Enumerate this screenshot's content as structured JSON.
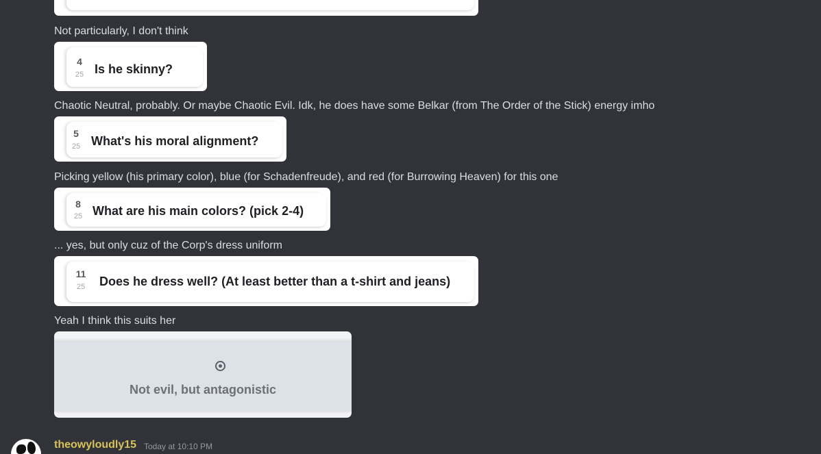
{
  "messages": [
    {
      "text": "Not particularly, I don't think"
    },
    {
      "text": "Chaotic Neutral, probably. Or maybe Chaotic Evil. Idk, he does have some Belkar (from The Order of the Stick) energy imho"
    },
    {
      "text": "Picking yellow (his primary color), blue (for Schadenfreude), and red (for Burrowing Heaven) for this one"
    },
    {
      "text": "... yes, but only cuz of the Corp's dress uniform"
    },
    {
      "text": "Yeah I think this suits her"
    }
  ],
  "questions": [
    {
      "number": "4",
      "total": "25",
      "question": "Is he skinny?"
    },
    {
      "number": "5",
      "total": "25",
      "question": "What's his moral alignment?"
    },
    {
      "number": "8",
      "total": "25",
      "question": "What are his main colors? (pick 2-4)"
    },
    {
      "number": "11",
      "total": "25",
      "question": "Does he dress well? (At least better than a t-shirt and jeans)"
    }
  ],
  "choice": {
    "icon": "radio-selected-icon",
    "label": "Not evil, but antagonistic"
  },
  "author": {
    "name": "theowyloudly15",
    "timestamp": "Today at 10:10 PM",
    "name_color": "#d8c35b"
  },
  "colors": {
    "background": "#313338",
    "text": "#dbdee1"
  }
}
